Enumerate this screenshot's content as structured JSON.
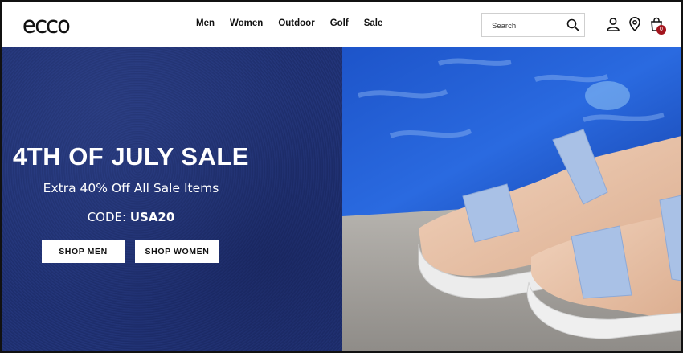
{
  "brand": {
    "logo_text": "ecco"
  },
  "nav": {
    "items": [
      "Men",
      "Women",
      "Outdoor",
      "Golf",
      "Sale"
    ]
  },
  "search": {
    "placeholder": "Search"
  },
  "cart": {
    "count": "0"
  },
  "hero": {
    "title": "4TH OF JULY SALE",
    "subtitle": "Extra 40% Off All Sale Items",
    "code_label": "CODE:",
    "code_value": "USA20",
    "buttons": {
      "shop_men": "SHOP MEN",
      "shop_women": "SHOP WOMEN"
    }
  },
  "icons": {
    "search": "search-icon",
    "account": "user-icon",
    "store": "location-pin-icon",
    "bag": "shopping-bag-icon"
  }
}
